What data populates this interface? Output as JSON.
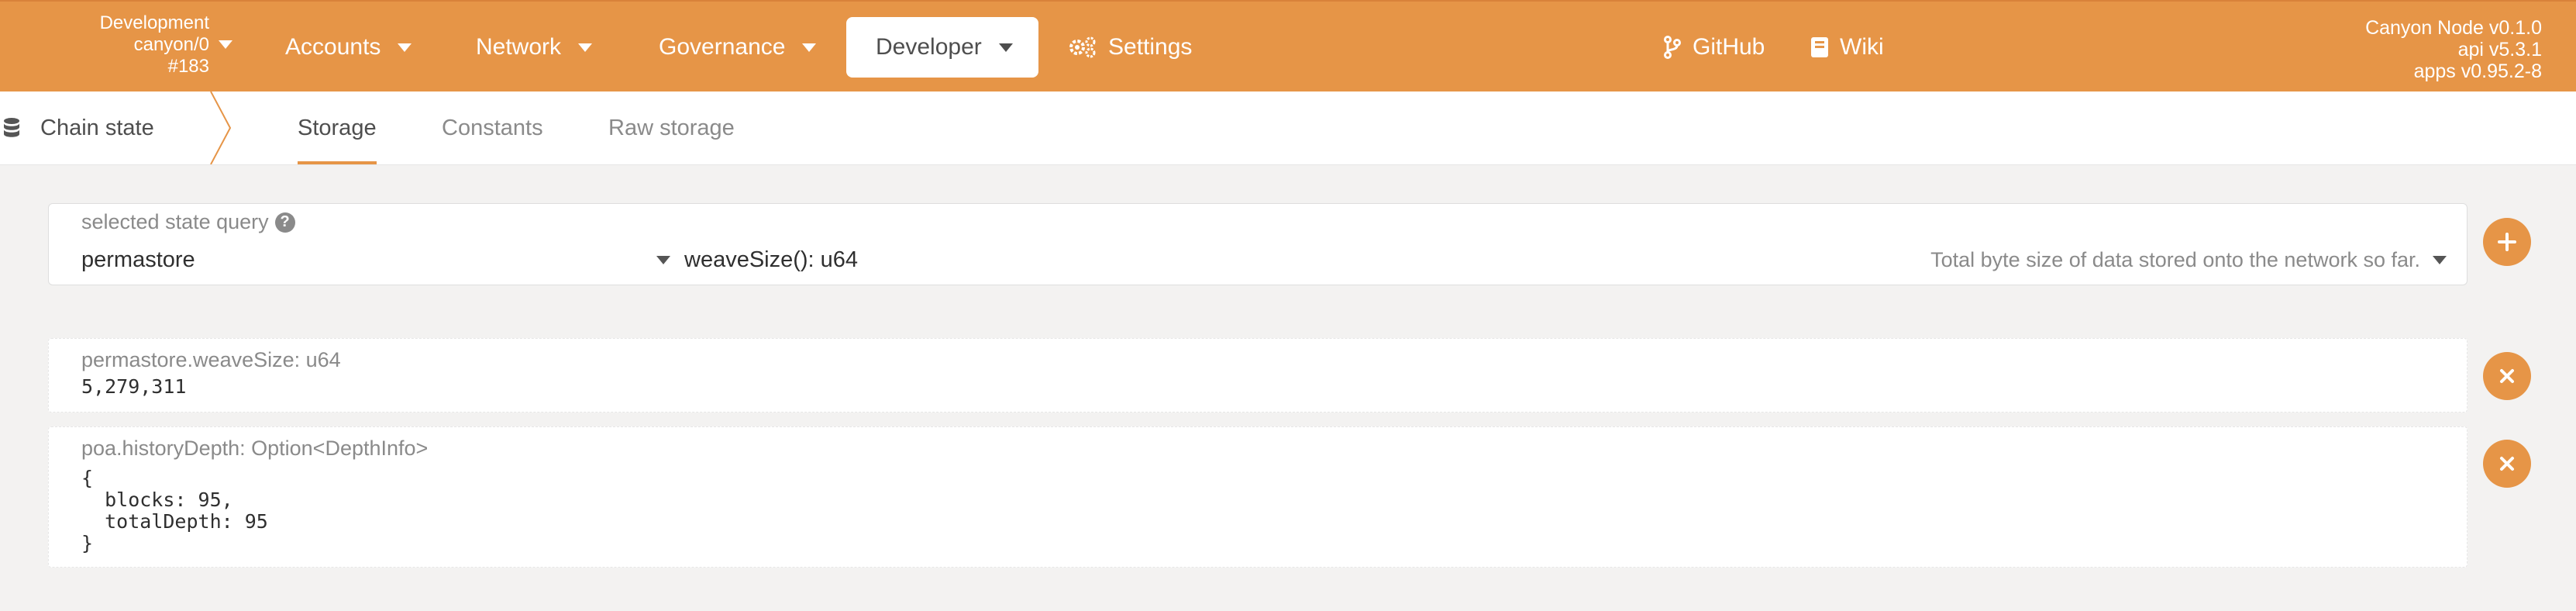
{
  "header": {
    "chain": {
      "name": "Development",
      "network": "canyon/0",
      "block": "#183"
    },
    "nav": [
      {
        "label": "Accounts"
      },
      {
        "label": "Network"
      },
      {
        "label": "Governance"
      },
      {
        "label": "Developer"
      },
      {
        "label": "Settings"
      }
    ],
    "links": [
      {
        "label": "GitHub"
      },
      {
        "label": "Wiki"
      }
    ],
    "node_info": {
      "node": "Canyon Node v0.1.0",
      "api": "api v5.3.1",
      "apps": "apps v0.95.2-8"
    }
  },
  "tabs": {
    "section_title": "Chain state",
    "items": [
      {
        "label": "Storage"
      },
      {
        "label": "Constants"
      },
      {
        "label": "Raw storage"
      }
    ]
  },
  "query": {
    "label": "selected state query",
    "module": "permastore",
    "method": "weaveSize(): u64",
    "description": "Total byte size of data stored onto the network so far."
  },
  "results": [
    {
      "label": "permastore.weaveSize: u64",
      "value": "5,279,311"
    },
    {
      "label": "poa.historyDepth: Option<DepthInfo>",
      "value": "{\n  blocks: 95,\n  totalDepth: 95\n}"
    }
  ],
  "colors": {
    "accent": "#e69547",
    "background": "#f3f2f1"
  },
  "icons": {
    "settings": "gears-icon",
    "github": "code-branch-icon",
    "wiki": "book-icon",
    "chain_state": "database-icon",
    "add": "plus-icon",
    "remove": "close-icon"
  }
}
